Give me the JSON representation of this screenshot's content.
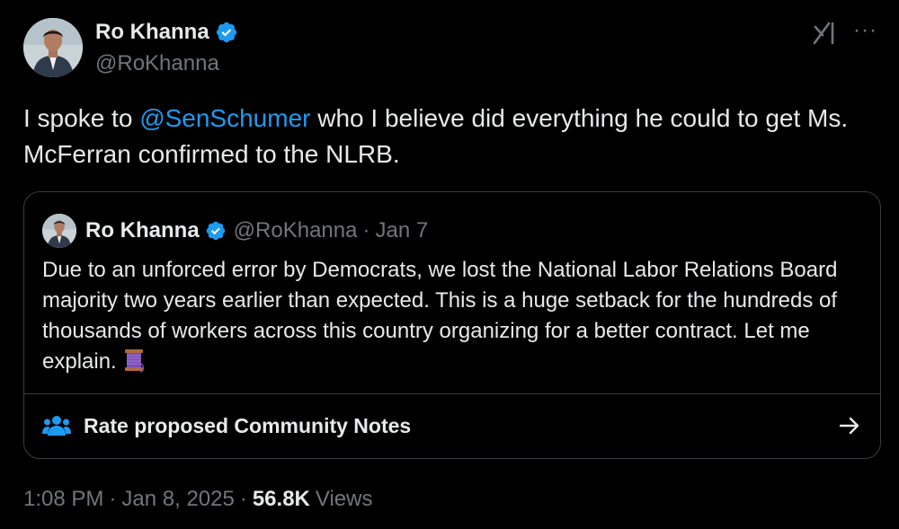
{
  "author": {
    "name": "Ro Khanna",
    "handle": "@RoKhanna",
    "avatar_icon": "portrait-avatar"
  },
  "tweet": {
    "text_before": "I spoke to ",
    "mention": "@SenSchumer",
    "text_after": " who I believe did everything he could to get Ms. McFerran confirmed to the NLRB."
  },
  "quoted": {
    "name": "Ro Khanna",
    "handle": "@RoKhanna",
    "dot": "·",
    "date": "Jan 7",
    "text": "Due to an unforced error by Democrats, we lost the National Labor Relations Board majority two years earlier than expected. This is a huge setback for the hundreds of thousands of workers across this country organizing for a better contract. Let me explain.",
    "emoji_icon": "thread-spool-icon"
  },
  "community_notes": {
    "label": "Rate proposed Community Notes",
    "icon": "people-icon"
  },
  "meta": {
    "time": "1:08 PM",
    "sep1": "·",
    "date": "Jan 8, 2025",
    "sep2": "·",
    "views_count": "56.8K",
    "views_label": "Views"
  },
  "colors": {
    "accent": "#1d9bf0",
    "background": "#000000",
    "muted": "#71767b",
    "text": "#e7e9ea"
  }
}
